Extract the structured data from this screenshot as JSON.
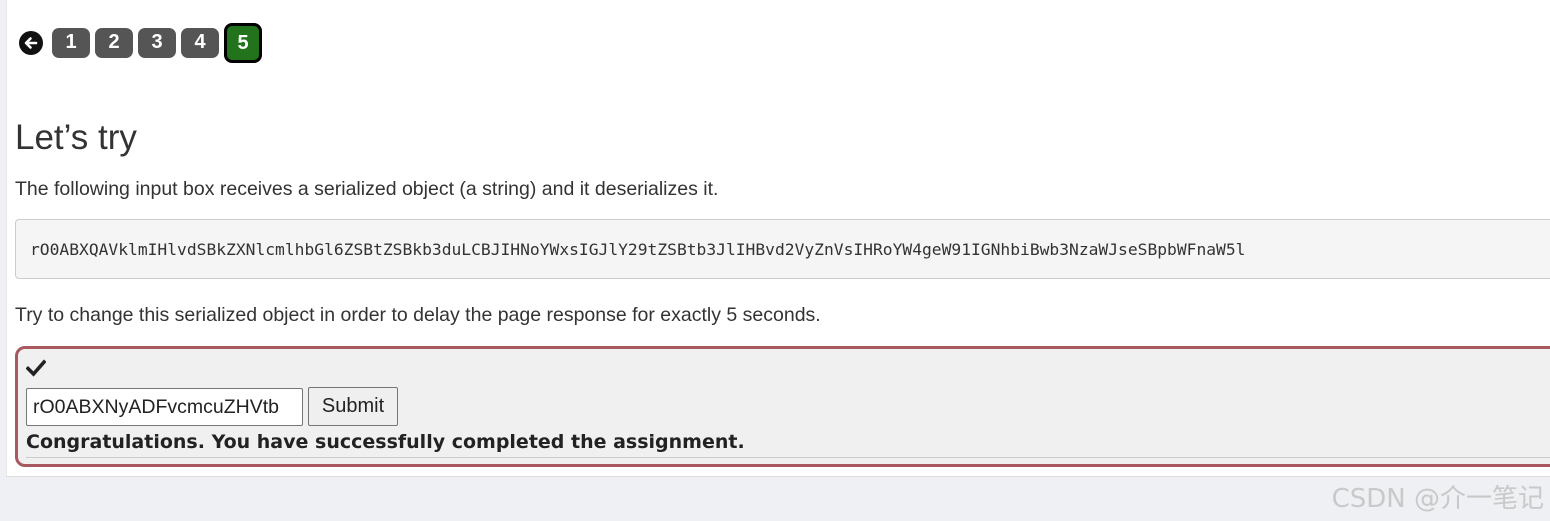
{
  "pagination": {
    "back_icon": "arrow-left-icon",
    "pages": [
      "1",
      "2",
      "3",
      "4",
      "5"
    ],
    "active_page": "5",
    "active_color": "#22731c",
    "inactive_color": "#555555"
  },
  "lesson": {
    "heading": "Let’s try",
    "intro": "The following input box receives a serialized object (a string) and it deserializes it.",
    "serialized_example": "rO0ABXQAVklmIHlvdSBkZXNlcmlhbGl6ZSBtZSBkb3duLCBJIHNoYWxsIGJlY29tZSBtb3JlIHBvd2VyZnVsIHRoYW4geW91IGNhbiBwb3NzaWJseSBpbWFnaW5l",
    "instruction": "Try to change this serialized object in order to delay the page response for exactly 5 seconds."
  },
  "attack_form": {
    "status_icon": "checkmark-icon",
    "token_value": "rO0ABXNyADFvcmcuZHVtb",
    "submit_label": "Submit",
    "feedback": "Congratulations. You have successfully completed the assignment.",
    "border_color": "#a8585e"
  },
  "watermark": "CSDN @介一笔记"
}
